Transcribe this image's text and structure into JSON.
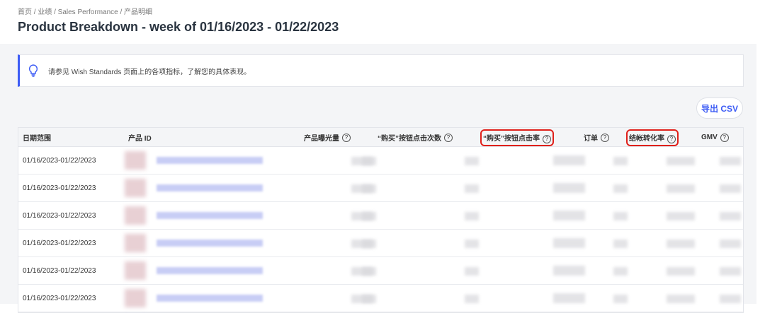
{
  "breadcrumb": "首页 / 业绩 / Sales Performance / 产品明细",
  "title": "Product Breakdown - week of 01/16/2023 - 01/22/2023",
  "notice": {
    "icon": "lightbulb-icon",
    "text": "请参见 Wish Standards 页面上的各项指标，了解您的具体表现。"
  },
  "export_button": "导出 CSV",
  "table": {
    "headers": [
      "日期范围",
      "产品 ID",
      "产品曝光量",
      "“购买”按钮点击次数",
      "“购买”按钮点击率",
      "订单",
      "结帐转化率",
      "GMV"
    ],
    "help": "?",
    "rows": [
      "01/16/2023-01/22/2023",
      "01/16/2023-01/22/2023",
      "01/16/2023-01/22/2023",
      "01/16/2023-01/22/2023",
      "01/16/2023-01/22/2023",
      "01/16/2023-01/22/2023"
    ]
  }
}
